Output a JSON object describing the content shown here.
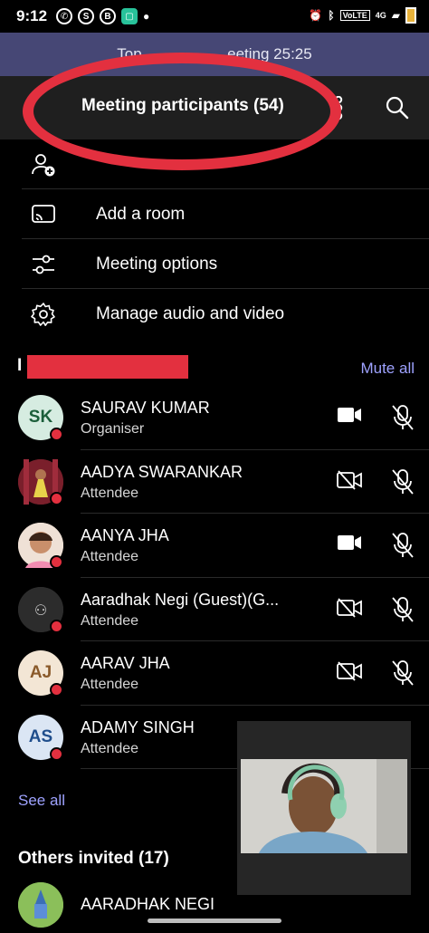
{
  "status_bar": {
    "time": "9:12",
    "network": "4G"
  },
  "banner": {
    "text": "Top                    eeting 25:25"
  },
  "header": {
    "title": "Meeting participants (54)"
  },
  "menu": [
    {
      "label": "",
      "icon": "add-person-icon"
    },
    {
      "label": "Add a room",
      "icon": "cast-icon"
    },
    {
      "label": "Meeting options",
      "icon": "sliders-icon"
    },
    {
      "label": "Manage audio and video",
      "icon": "gear-icon"
    }
  ],
  "section": {
    "prefix": "I",
    "action": "Mute all"
  },
  "participants": [
    {
      "initials": "SK",
      "name": "SAURAV KUMAR",
      "role": "Organiser",
      "camera": "on",
      "mic": "muted",
      "avatar_bg": "#d6ece1",
      "avatar_fg": "#1b5e3a"
    },
    {
      "initials": "",
      "name": "AADYA SWARANKAR",
      "role": "Attendee",
      "camera": "off",
      "mic": "muted",
      "avatar_bg": "#7a1f2b",
      "avatar_fg": "#fff"
    },
    {
      "initials": "",
      "name": "AANYA JHA",
      "role": "Attendee",
      "camera": "on",
      "mic": "muted",
      "avatar_bg": "#e9d3c4",
      "avatar_fg": "#fff"
    },
    {
      "initials": "",
      "name": "Aaradhak Negi  (Guest)(G...",
      "role": "Attendee",
      "camera": "off",
      "mic": "muted",
      "avatar_bg": "#2c2c2c",
      "avatar_fg": "#fff"
    },
    {
      "initials": "AJ",
      "name": "AARAV JHA",
      "role": "Attendee",
      "camera": "off",
      "mic": "muted",
      "avatar_bg": "#f3e6d5",
      "avatar_fg": "#8a5a2b"
    },
    {
      "initials": "AS",
      "name": "ADAMY SINGH",
      "role": "Attendee",
      "camera": "off",
      "mic": "muted",
      "avatar_bg": "#dbe6f4",
      "avatar_fg": "#1f4e8c"
    }
  ],
  "see_all": "See all",
  "others_invited": "Others invited (17)",
  "invited": [
    {
      "name": "AARADHAK NEGI"
    }
  ],
  "colors": {
    "accent": "#9ea2ff",
    "banner": "#464775",
    "annotation": "#e3303f"
  }
}
